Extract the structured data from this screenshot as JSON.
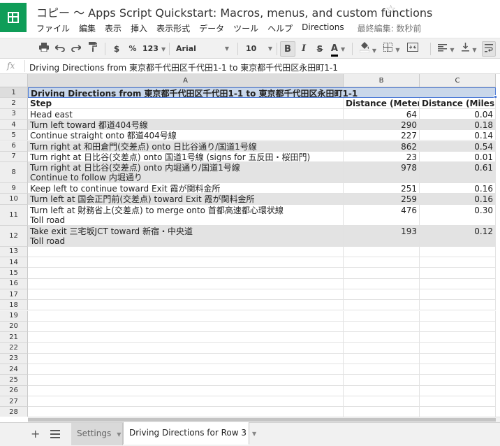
{
  "doc": {
    "title": "コピー ～ Apps Script Quickstart: Macros, menus, and custom functions",
    "star_icon": "star-outline-icon"
  },
  "menu": {
    "items": [
      "ファイル",
      "編集",
      "表示",
      "挿入",
      "表示形式",
      "データ",
      "ツール",
      "ヘルプ",
      "Directions"
    ],
    "last_edit": "最終編集: 数秒前"
  },
  "toolbar": {
    "currency": "$",
    "percent": "%",
    "number_format": "123",
    "font_family": "Arial",
    "font_size": "10",
    "bold": "B",
    "italic": "I",
    "strikethrough": "S",
    "text_color": "A"
  },
  "formula_bar": {
    "fx_label": "fx",
    "content": "Driving Directions from 東京都千代田区千代田1-1 to 東京都千代田区永田町1-1"
  },
  "columns": [
    "A",
    "B",
    "C"
  ],
  "rows": [
    {
      "num": "1",
      "a": "Driving Directions from 東京都千代田区千代田1-1 to 東京都千代田区永田町1-1",
      "a2": "",
      "b": "",
      "c": ""
    },
    {
      "num": "2",
      "a": "Step",
      "a2": "",
      "b": "Distance (Meters)",
      "c": "Distance (Miles)"
    },
    {
      "num": "3",
      "a": "Head east",
      "a2": "",
      "b": "64",
      "c": "0.04"
    },
    {
      "num": "4",
      "a": "Turn left toward 都道404号線",
      "a2": "",
      "b": "290",
      "c": "0.18"
    },
    {
      "num": "5",
      "a": "Continue straight onto 都道404号線",
      "a2": "",
      "b": "227",
      "c": "0.14"
    },
    {
      "num": "6",
      "a": "Turn right at 和田倉門(交差点) onto 日比谷通り/国道1号線",
      "a2": "",
      "b": "862",
      "c": "0.54"
    },
    {
      "num": "7",
      "a": "Turn right at 日比谷(交差点) onto 国道1号線 (signs for 五反田・桜田門)",
      "a2": "",
      "b": "23",
      "c": "0.01"
    },
    {
      "num": "8",
      "a": "Turn right at 日比谷(交差点) onto 内堀通り/国道1号線",
      "a2": "Continue to follow 内堀通り",
      "b": "978",
      "c": "0.61"
    },
    {
      "num": "9",
      "a": "Keep left to continue toward Exit 霞が関料金所",
      "a2": "",
      "b": "251",
      "c": "0.16"
    },
    {
      "num": "10",
      "a": "Turn left at 国会正門前(交差点) toward Exit 霞が関料金所",
      "a2": "",
      "b": "259",
      "c": "0.16"
    },
    {
      "num": "11",
      "a": "Turn left at 財務省上(交差点) to merge onto 首都高速都心環状線",
      "a2": "Toll road",
      "b": "476",
      "c": "0.30"
    },
    {
      "num": "12",
      "a": "Take exit 三宅坂JCT toward 新宿・中央道",
      "a2": "Toll road",
      "b": "193",
      "c": "0.12"
    },
    {
      "num": "13",
      "a": "",
      "a2": "",
      "b": "",
      "c": ""
    },
    {
      "num": "14",
      "a": "",
      "a2": "",
      "b": "",
      "c": ""
    },
    {
      "num": "15",
      "a": "",
      "a2": "",
      "b": "",
      "c": ""
    },
    {
      "num": "16",
      "a": "",
      "a2": "",
      "b": "",
      "c": ""
    },
    {
      "num": "17",
      "a": "",
      "a2": "",
      "b": "",
      "c": ""
    },
    {
      "num": "18",
      "a": "",
      "a2": "",
      "b": "",
      "c": ""
    },
    {
      "num": "19",
      "a": "",
      "a2": "",
      "b": "",
      "c": ""
    },
    {
      "num": "20",
      "a": "",
      "a2": "",
      "b": "",
      "c": ""
    },
    {
      "num": "21",
      "a": "",
      "a2": "",
      "b": "",
      "c": ""
    },
    {
      "num": "22",
      "a": "",
      "a2": "",
      "b": "",
      "c": ""
    },
    {
      "num": "23",
      "a": "",
      "a2": "",
      "b": "",
      "c": ""
    },
    {
      "num": "24",
      "a": "",
      "a2": "",
      "b": "",
      "c": ""
    },
    {
      "num": "25",
      "a": "",
      "a2": "",
      "b": "",
      "c": ""
    },
    {
      "num": "26",
      "a": "",
      "a2": "",
      "b": "",
      "c": ""
    },
    {
      "num": "27",
      "a": "",
      "a2": "",
      "b": "",
      "c": ""
    },
    {
      "num": "28",
      "a": "",
      "a2": "",
      "b": "",
      "c": ""
    }
  ],
  "sheets": {
    "tabs": [
      "Settings",
      "Driving Directions for Row 3"
    ],
    "active_index": 1
  },
  "colors": {
    "brand": "#0f9d58",
    "selection": "#4d7bd6",
    "selection_fill": "#c9d7ea",
    "shaded_row": "#e3e3e3"
  }
}
